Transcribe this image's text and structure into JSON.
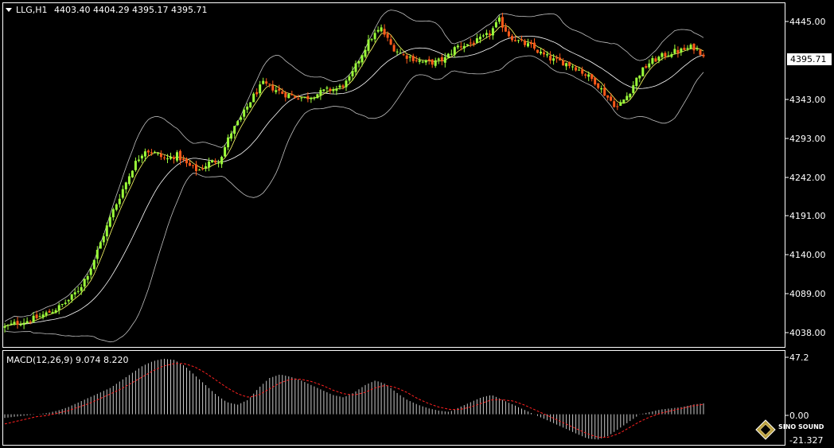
{
  "main_header": {
    "dropdown_icon": "triangle-down-icon",
    "symbol": "LLG,H1",
    "ohlc": "4403.40 4404.29 4395.17 4395.71"
  },
  "main_axis": {
    "ticks": [
      "4445.00",
      "4395.71",
      "4343.00",
      "4293.00",
      "4242.00",
      "4191.00",
      "4140.00",
      "4089.00",
      "4038.00"
    ],
    "current_price": "4395.71",
    "ylim": [
      4025,
      4460
    ]
  },
  "macd_header": {
    "label": "MACD(12,26,9) 9.074 8.220"
  },
  "macd_axis": {
    "ticks": [
      "47.2",
      "0.00",
      "-21.327"
    ],
    "ylim": [
      -21.327,
      47.2
    ]
  },
  "logo": {
    "icon": "sino-sound-logo-icon",
    "text": "SINO SOUND"
  },
  "colors": {
    "bull": "#9cff3a",
    "bear": "#ff5a1a",
    "band": "#c0c0c0",
    "fast_ma": "#ffff66",
    "macd_hist": "#c8c8c8",
    "signal": "#ff2020"
  },
  "chart_data": [
    {
      "type": "candlestick",
      "title": "LLG,H1",
      "approx_close_path": [
        4050,
        4055,
        4058,
        4062,
        4068,
        4075,
        4085,
        4100,
        4125,
        4160,
        4195,
        4225,
        4255,
        4275,
        4270,
        4262,
        4268,
        4255,
        4248,
        4258,
        4262,
        4295,
        4315,
        4340,
        4358,
        4352,
        4345,
        4342,
        4340,
        4345,
        4350,
        4352,
        4362,
        4390,
        4415,
        4428,
        4405,
        4395,
        4390,
        4385,
        4385,
        4390,
        4405,
        4408,
        4412,
        4420,
        4438,
        4418,
        4410,
        4405,
        4395,
        4388,
        4385,
        4380,
        4370,
        4360,
        4342,
        4328,
        4345,
        4370,
        4385,
        4392,
        4398,
        4400,
        4405,
        4395.71
      ],
      "ylim": [
        4025,
        4460
      ]
    },
    {
      "type": "bar",
      "title": "MACD(12,26,9) 9.074 8.220",
      "approx_histogram_path": [
        -3,
        -2,
        -1,
        0,
        1,
        3,
        6,
        10,
        14,
        18,
        22,
        28,
        34,
        40,
        44,
        46,
        45,
        40,
        32,
        24,
        16,
        10,
        8,
        12,
        22,
        30,
        33,
        31,
        28,
        24,
        20,
        16,
        14,
        18,
        24,
        28,
        25,
        18,
        12,
        8,
        5,
        3,
        2,
        6,
        10,
        14,
        16,
        12,
        8,
        4,
        0,
        -4,
        -8,
        -12,
        -16,
        -20,
        -21,
        -18,
        -12,
        -6,
        0,
        2,
        4,
        5,
        6,
        8,
        9.074
      ],
      "approx_signal_path": [
        -8,
        -6,
        -4,
        -2,
        -1,
        1,
        3,
        6,
        9,
        13,
        17,
        21,
        26,
        31,
        36,
        40,
        42,
        42,
        39,
        34,
        28,
        22,
        17,
        14,
        16,
        21,
        26,
        29,
        29,
        27,
        24,
        20,
        17,
        16,
        18,
        22,
        24,
        22,
        18,
        13,
        9,
        6,
        4,
        4,
        6,
        9,
        12,
        12,
        11,
        8,
        4,
        0,
        -4,
        -8,
        -12,
        -16,
        -19,
        -19,
        -16,
        -11,
        -6,
        -2,
        1,
        3,
        5,
        7,
        8.22
      ],
      "ylim": [
        -21.327,
        47.2
      ]
    }
  ]
}
